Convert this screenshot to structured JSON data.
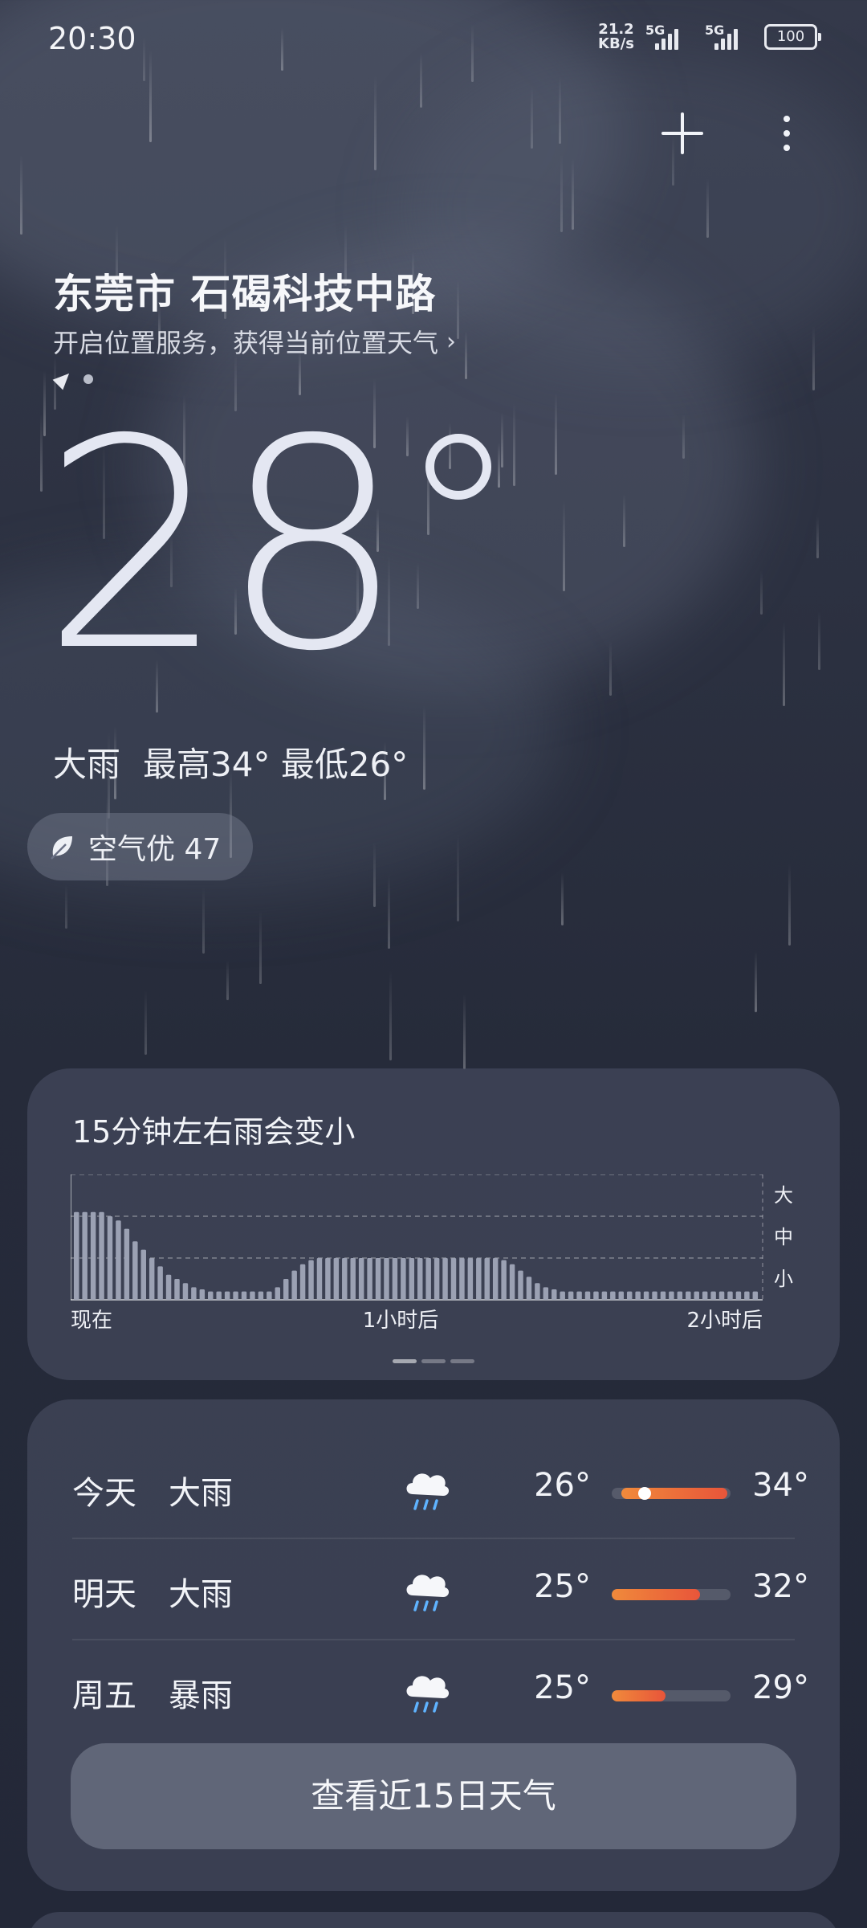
{
  "status_bar": {
    "time": "20:30",
    "net_speed_value": "21.2",
    "net_speed_unit": "KB/s",
    "sim1": "5G",
    "sim2": "5G",
    "battery": "100"
  },
  "location": {
    "name": "东莞市 石碣科技中路",
    "hint": "开启位置服务，获得当前位置天气",
    "hint_chevron": "›"
  },
  "current": {
    "temperature": "28",
    "condition": "大雨",
    "high": "最高34°",
    "low": "最低26°"
  },
  "aqi": {
    "label": "空气优 47",
    "icon": "leaf-icon"
  },
  "rain_card": {
    "title": "15分钟左右雨会变小",
    "levels": [
      "大",
      "中",
      "小"
    ],
    "x_labels": [
      "现在",
      "1小时后",
      "2小时后"
    ]
  },
  "chart_data": {
    "type": "bar",
    "title": "15分钟左右雨会变小",
    "xlabel": "",
    "ylabel": "",
    "y_categories": [
      "小",
      "中",
      "大"
    ],
    "ylim": [
      0,
      3
    ],
    "x_tick_labels": [
      "现在",
      "1小时后",
      "2小时后"
    ],
    "values": [
      2.1,
      2.1,
      2.1,
      2.1,
      2.0,
      1.9,
      1.7,
      1.4,
      1.2,
      1.0,
      0.8,
      0.6,
      0.5,
      0.4,
      0.3,
      0.25,
      0.2,
      0.2,
      0.2,
      0.2,
      0.2,
      0.2,
      0.2,
      0.2,
      0.3,
      0.5,
      0.7,
      0.85,
      0.95,
      1.0,
      1.0,
      1.0,
      1.0,
      1.0,
      1.0,
      1.0,
      1.0,
      1.0,
      1.0,
      1.0,
      1.0,
      1.0,
      1.0,
      1.0,
      1.0,
      1.0,
      1.0,
      1.0,
      1.0,
      1.0,
      1.0,
      0.95,
      0.85,
      0.7,
      0.55,
      0.4,
      0.3,
      0.25,
      0.2,
      0.2,
      0.2,
      0.2,
      0.2,
      0.2,
      0.2,
      0.2,
      0.2,
      0.2,
      0.2,
      0.2,
      0.2,
      0.2,
      0.2,
      0.2,
      0.2,
      0.2,
      0.2,
      0.2,
      0.2,
      0.2,
      0.2,
      0.2
    ]
  },
  "forecast": {
    "rows": [
      {
        "day": "今天",
        "condition": "大雨",
        "icon": "rain-cloud-icon",
        "low": "26°",
        "high": "34°",
        "bar_start": 0.08,
        "bar_end": 0.97,
        "current": 0.28
      },
      {
        "day": "明天",
        "condition": "大雨",
        "icon": "rain-cloud-icon",
        "low": "25°",
        "high": "32°",
        "bar_start": 0.0,
        "bar_end": 0.74
      },
      {
        "day": "周五",
        "condition": "暴雨",
        "icon": "rain-cloud-icon",
        "low": "25°",
        "high": "29°",
        "bar_start": 0.0,
        "bar_end": 0.45
      }
    ],
    "more_button": "查看近15日天气"
  },
  "colors": {
    "bar_gradient_start": "#f08a3b",
    "bar_gradient_end": "#e8553a",
    "rain_bar": "#9ba1b3"
  }
}
